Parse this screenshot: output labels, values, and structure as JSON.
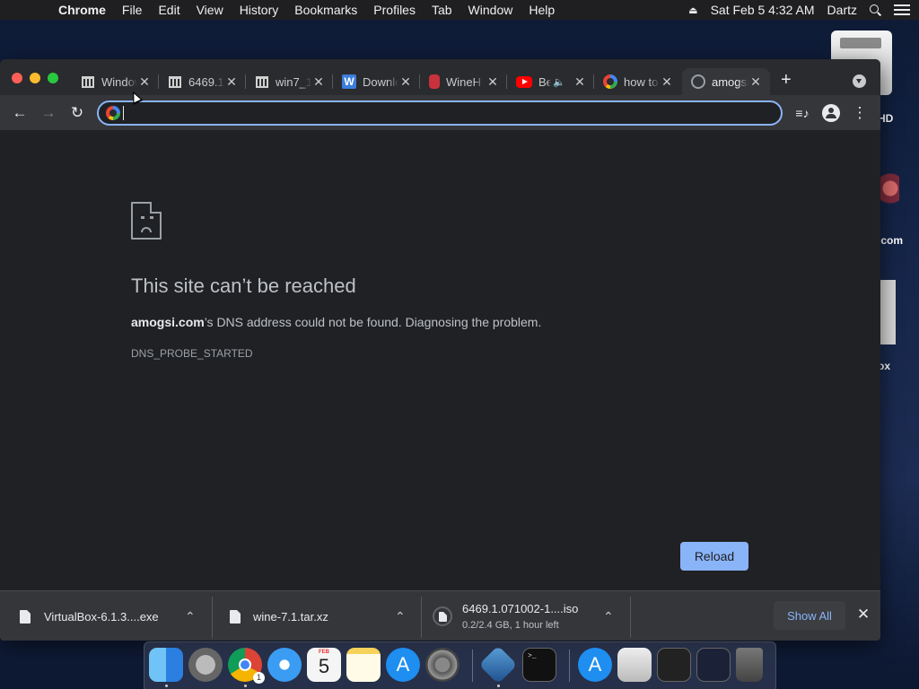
{
  "menubar": {
    "apple_icon": "apple-icon",
    "app_name": "Chrome",
    "items": [
      "File",
      "Edit",
      "View",
      "History",
      "Bookmarks",
      "Profiles",
      "Tab",
      "Window",
      "Help"
    ],
    "datetime": "Sat Feb 5  4:32 AM",
    "user": "Dartz"
  },
  "desktop": {
    "items": [
      {
        "label": "HD"
      },
      {
        "label": ".com"
      },
      {
        "label": "ox"
      }
    ]
  },
  "browser": {
    "tabs": [
      {
        "title": "Windows",
        "icon": "museum-icon"
      },
      {
        "title": "6469.1",
        "icon": "museum-icon"
      },
      {
        "title": "win7_1",
        "icon": "museum-icon"
      },
      {
        "title": "Download",
        "icon": "blue-w-icon"
      },
      {
        "title": "WineH",
        "icon": "wine-icon"
      },
      {
        "title": "Be",
        "icon": "youtube-icon",
        "audio": "speaker-icon"
      },
      {
        "title": "how to",
        "icon": "google-icon"
      },
      {
        "title": "amogsi",
        "icon": "globe-icon",
        "active": true
      }
    ],
    "new_tab_label": "+",
    "omnibox": {
      "value": ""
    },
    "error": {
      "title": "This site can’t be reached",
      "domain": "amogsi.com",
      "description": "’s DNS address could not be found. Diagnosing the problem.",
      "code": "DNS_PROBE_STARTED",
      "reload_label": "Reload"
    },
    "downloads": [
      {
        "name": "VirtualBox-6.1.3....exe"
      },
      {
        "name": "wine-7.1.tar.xz"
      },
      {
        "name": "6469.1.071002-1....iso",
        "status": "0.2/2.4 GB, 1 hour left",
        "progress": 0.083
      }
    ],
    "show_all_label": "Show All"
  },
  "dock": {
    "chrome_badge": "1",
    "calendar_month": "FEB",
    "calendar_day": "5",
    "terminal_prompt": ">_"
  },
  "colors": {
    "accent": "#8ab4f8",
    "window_bg": "#202124",
    "toolbar_bg": "#35363a"
  }
}
